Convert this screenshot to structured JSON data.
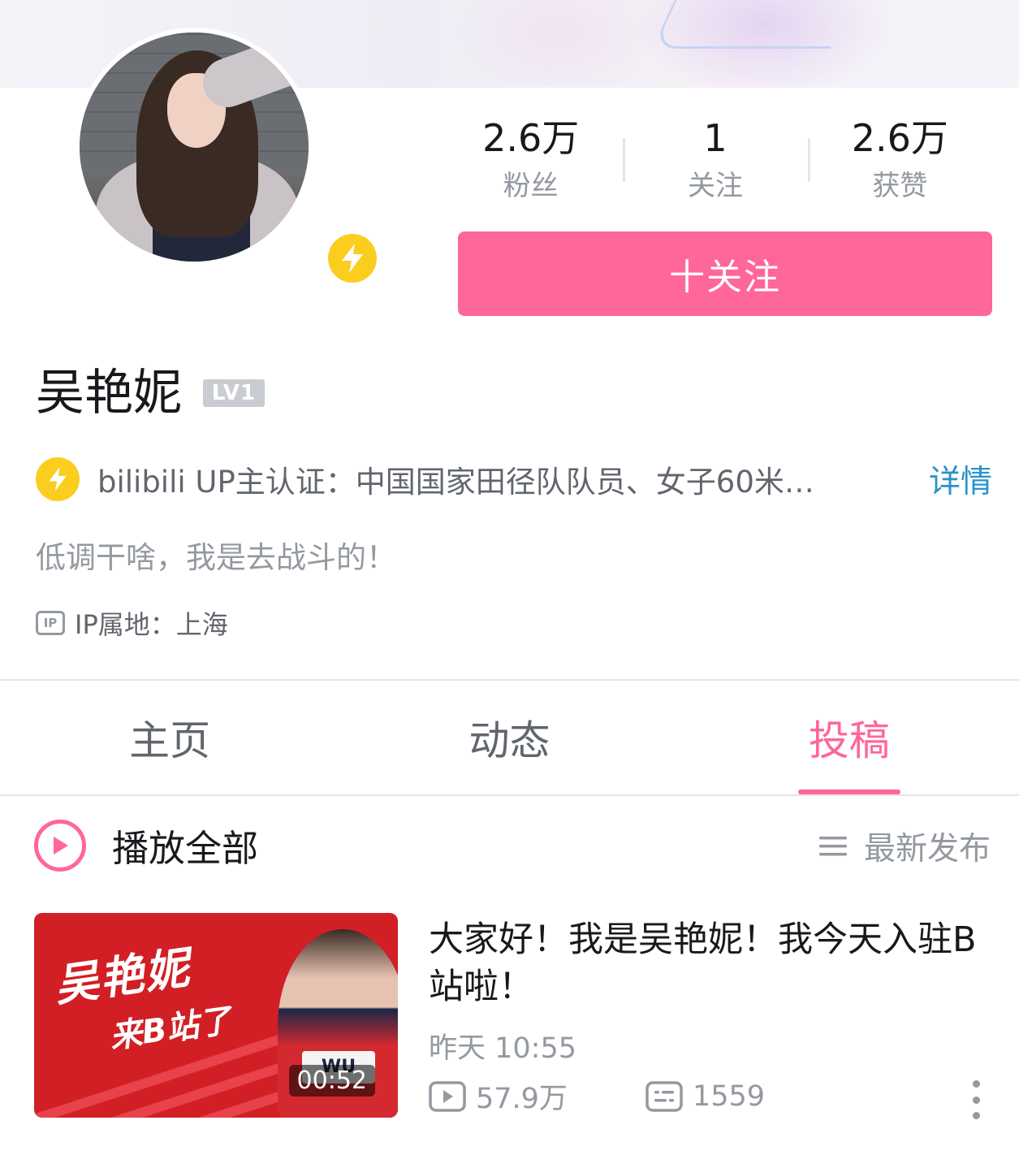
{
  "profile": {
    "name": "吴艳妮",
    "level": "LV1",
    "stats": [
      {
        "value": "2.6万",
        "label": "粉丝"
      },
      {
        "value": "1",
        "label": "关注"
      },
      {
        "value": "2.6万",
        "label": "获赞"
      }
    ],
    "follow_label": "十关注",
    "verification": "bilibili UP主认证：中国国家田径队队员、女子60米…",
    "verification_detail": "详情",
    "signature": "低调干啥，我是去战斗的！",
    "ip_badge": "IP",
    "ip_location": "IP属地：上海"
  },
  "tabs": [
    {
      "label": "主页",
      "active": false
    },
    {
      "label": "动态",
      "active": false
    },
    {
      "label": "投稿",
      "active": true
    }
  ],
  "toolbar": {
    "play_all_label": "播放全部",
    "sort_label": "最新发布"
  },
  "video": {
    "thumb_title_1": "吴艳妮",
    "thumb_title_2": "来B站了",
    "thumb_jersey": "WU",
    "duration": "00:52",
    "title": "大家好！我是吴艳妮！我今天入驻B站啦！",
    "time": "昨天 10:55",
    "plays": "57.9万",
    "danmaku": "1559"
  },
  "colors": {
    "accent": "#ff6699",
    "verify_gold": "#fbcd1e",
    "link_blue": "#2a93c9",
    "muted": "#9499a0"
  }
}
